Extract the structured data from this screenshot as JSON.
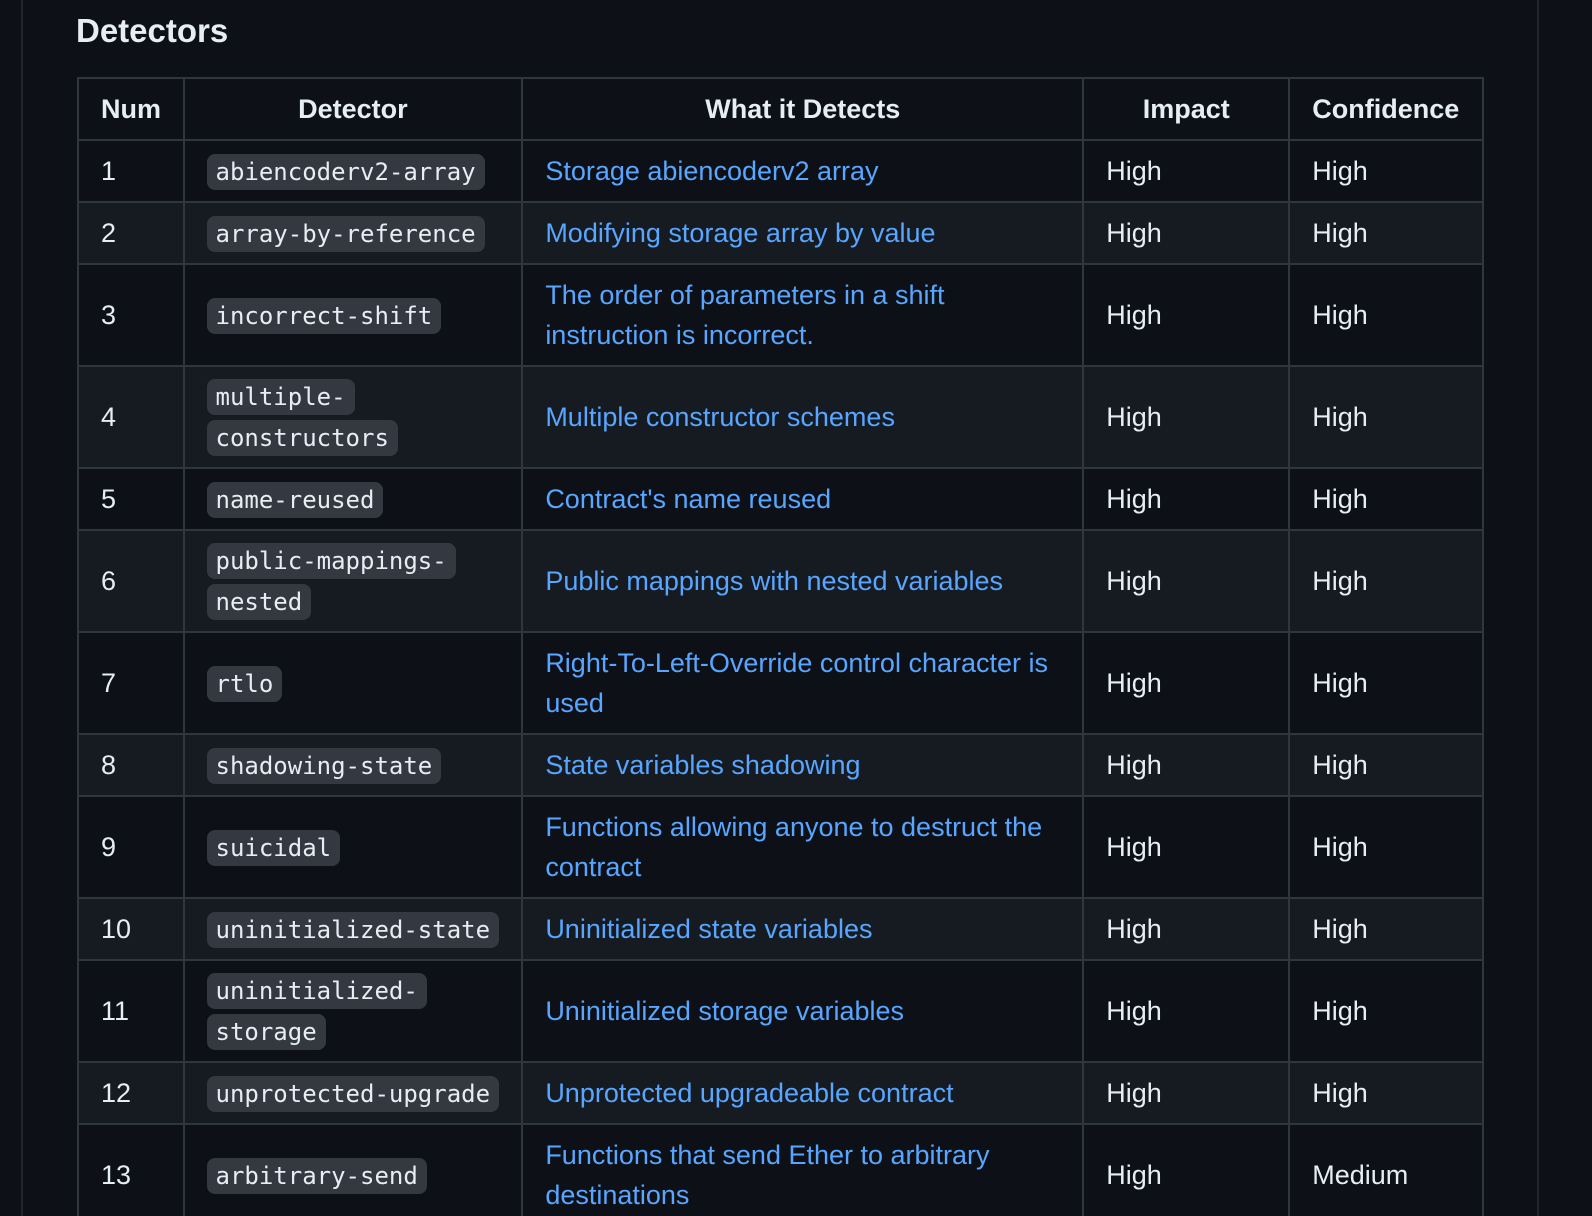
{
  "section": {
    "title": "Detectors"
  },
  "table": {
    "headers": [
      "Num",
      "Detector",
      "What it Detects",
      "Impact",
      "Confidence"
    ],
    "rows": [
      {
        "num": "1",
        "detector": "abiencoderv2-array",
        "detects": "Storage abiencoderv2 array",
        "impact": "High",
        "confidence": "High"
      },
      {
        "num": "2",
        "detector": "array-by-reference",
        "detects": "Modifying storage array by value",
        "impact": "High",
        "confidence": "High"
      },
      {
        "num": "3",
        "detector": "incorrect-shift",
        "detects": "The order of parameters in a shift instruction is incorrect.",
        "impact": "High",
        "confidence": "High"
      },
      {
        "num": "4",
        "detector": "multiple-constructors",
        "detects": "Multiple constructor schemes",
        "impact": "High",
        "confidence": "High"
      },
      {
        "num": "5",
        "detector": "name-reused",
        "detects": "Contract's name reused",
        "impact": "High",
        "confidence": "High"
      },
      {
        "num": "6",
        "detector": "public-mappings-nested",
        "detects": "Public mappings with nested variables",
        "impact": "High",
        "confidence": "High"
      },
      {
        "num": "7",
        "detector": "rtlo",
        "detects": "Right-To-Left-Override control character is used",
        "impact": "High",
        "confidence": "High"
      },
      {
        "num": "8",
        "detector": "shadowing-state",
        "detects": "State variables shadowing",
        "impact": "High",
        "confidence": "High"
      },
      {
        "num": "9",
        "detector": "suicidal",
        "detects": "Functions allowing anyone to destruct the contract",
        "impact": "High",
        "confidence": "High"
      },
      {
        "num": "10",
        "detector": "uninitialized-state",
        "detects": "Uninitialized state variables",
        "impact": "High",
        "confidence": "High"
      },
      {
        "num": "11",
        "detector": "uninitialized-storage",
        "detects": "Uninitialized storage variables",
        "impact": "High",
        "confidence": "High"
      },
      {
        "num": "12",
        "detector": "unprotected-upgrade",
        "detects": "Unprotected upgradeable contract",
        "impact": "High",
        "confidence": "High"
      },
      {
        "num": "13",
        "detector": "arbitrary-send",
        "detects": "Functions that send Ether to arbitrary destinations",
        "impact": "High",
        "confidence": "Medium"
      }
    ]
  },
  "colors": {
    "background": "#0d1117",
    "row_alt": "#161b22",
    "border": "#30363d",
    "link": "#58a6ff",
    "code_bg": "#343941",
    "text": "#e6edf3"
  }
}
